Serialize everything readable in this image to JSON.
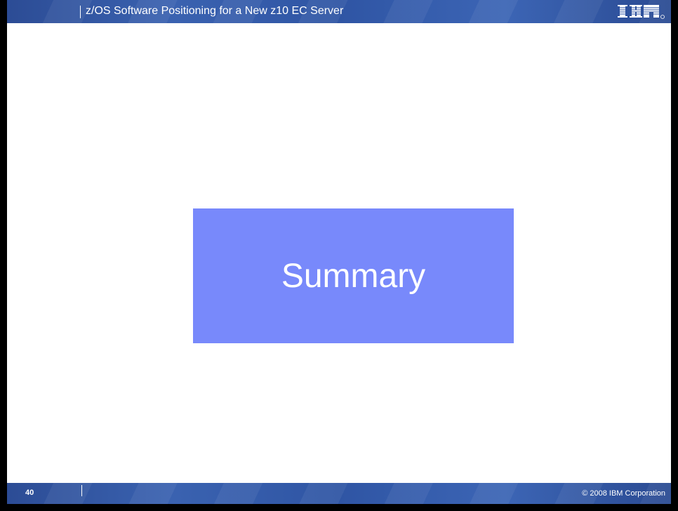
{
  "header": {
    "title": "z/OS Software Positioning for a New z10 EC Server",
    "logo_text": "IBM"
  },
  "body": {
    "section_title": "Summary"
  },
  "footer": {
    "page_number": "40",
    "copyright": "© 2008 IBM Corporation"
  },
  "colors": {
    "bar": "#2f55a4",
    "summary_box": "#7889fb",
    "border": "#000000"
  }
}
